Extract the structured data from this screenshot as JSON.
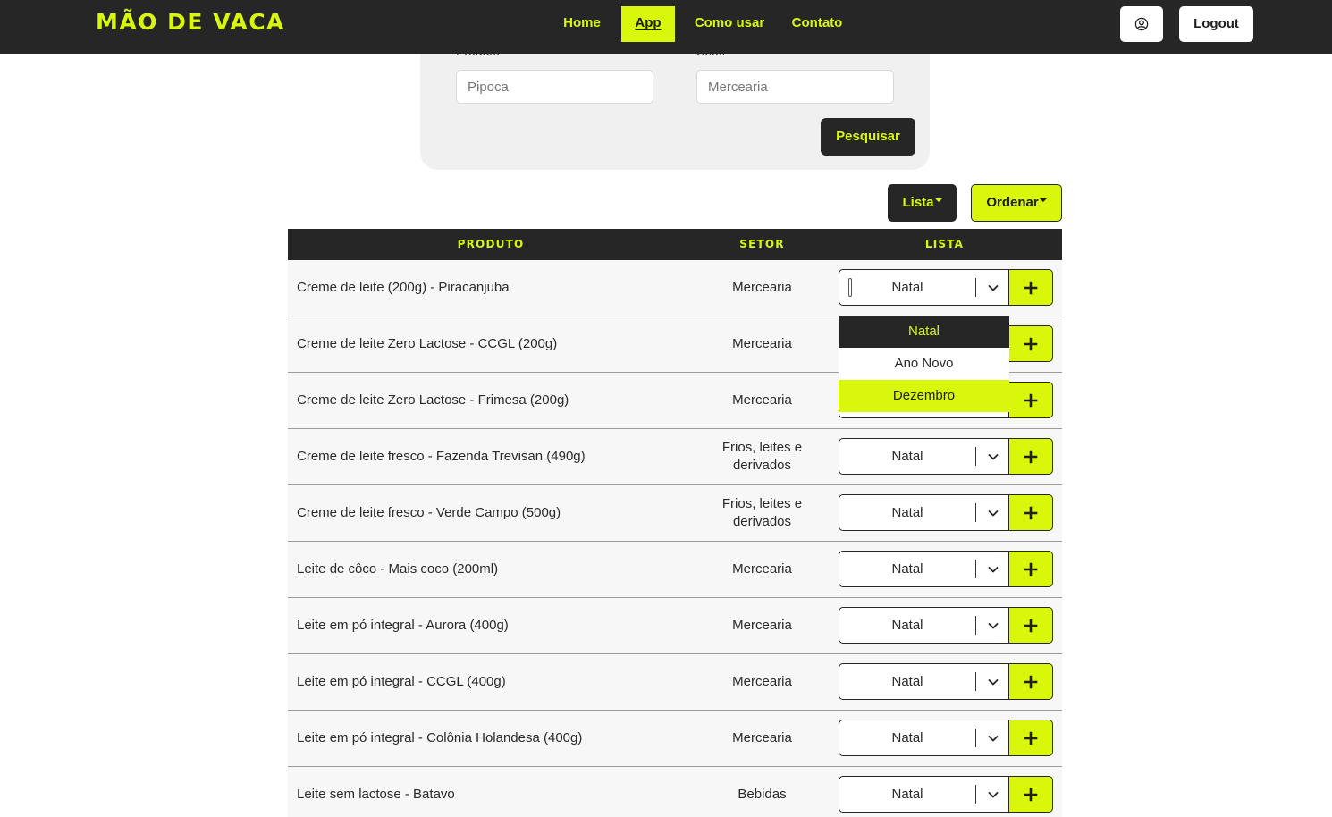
{
  "nav": {
    "brand": "MÃO DE VACA",
    "links": [
      {
        "label": "Home"
      },
      {
        "label": "App"
      },
      {
        "label": "Como usar"
      },
      {
        "label": "Contato"
      }
    ],
    "logout_label": "Logout"
  },
  "search": {
    "produto_label": "Produto",
    "setor_label": "Setor",
    "produto_placeholder": "Pipoca",
    "setor_placeholder": "Mercearia",
    "submit_label": "Pesquisar"
  },
  "actions": {
    "lista_label": "Lista",
    "ordenar_label": "Ordenar"
  },
  "table": {
    "headers": [
      "PRODUTO",
      "SETOR",
      "LISTA"
    ],
    "rows": [
      {
        "produto": "Creme de leite (200g) - Piracanjuba",
        "setor": "Mercearia",
        "lista": "Natal"
      },
      {
        "produto": "Creme de leite Zero Lactose - CCGL (200g)",
        "setor": "Mercearia",
        "lista": "Natal"
      },
      {
        "produto": "Creme de leite Zero Lactose - Frimesa (200g)",
        "setor": "Mercearia",
        "lista": "Natal"
      },
      {
        "produto": "Creme de leite fresco - Fazenda Trevisan (490g)",
        "setor": "Frios, leites e derivados",
        "lista": "Natal"
      },
      {
        "produto": "Creme de leite fresco - Verde Campo (500g)",
        "setor": "Frios, leites e derivados",
        "lista": "Natal"
      },
      {
        "produto": "Leite de côco - Mais coco (200ml)",
        "setor": "Mercearia",
        "lista": "Natal"
      },
      {
        "produto": "Leite em pó integral - Aurora (400g)",
        "setor": "Mercearia",
        "lista": "Natal"
      },
      {
        "produto": "Leite em pó integral - CCGL (400g)",
        "setor": "Mercearia",
        "lista": "Natal"
      },
      {
        "produto": "Leite em pó integral - Colônia Holandesa (400g)",
        "setor": "Mercearia",
        "lista": "Natal"
      },
      {
        "produto": "Leite sem lactose - Batavo",
        "setor": "Bebidas",
        "lista": "Natal"
      }
    ]
  },
  "dropdown": {
    "options": [
      "Natal",
      "Ano Novo",
      "Dezembro"
    ],
    "selected": "Natal",
    "hovered": "Dezembro"
  },
  "colors": {
    "accent": "#d8f70a",
    "dark": "#262626"
  },
  "icons": {
    "user": "user-circle-icon",
    "chevron": "chevron-down-icon",
    "add": "plus-icon"
  }
}
